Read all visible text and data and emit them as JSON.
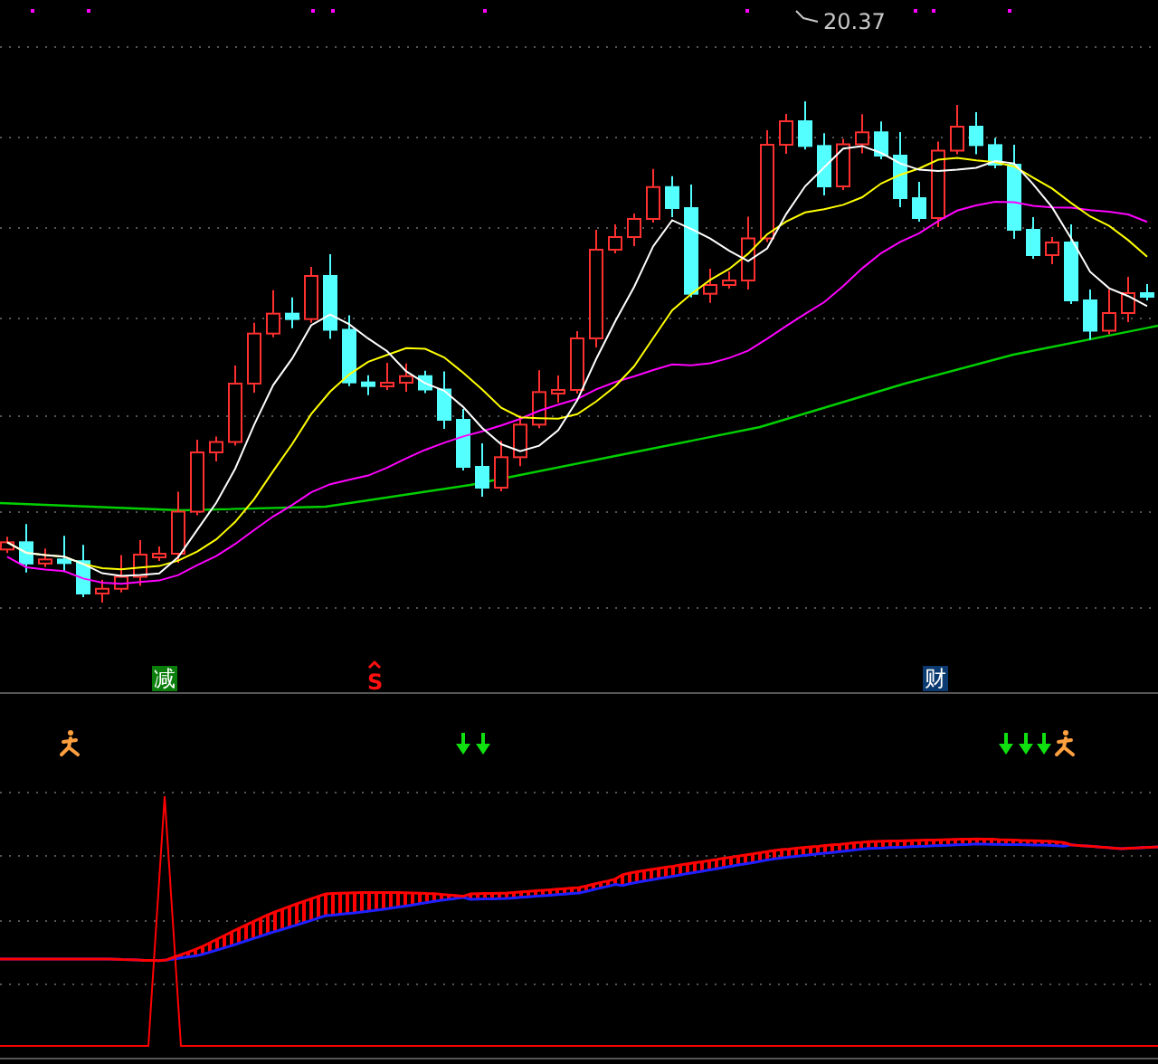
{
  "price_panel": {
    "high_label": "20.37",
    "signals": [
      {
        "kind": "tag",
        "text": "减",
        "color": "#0b7d0b"
      },
      {
        "kind": "letter",
        "text": "S",
        "color": "#ff1010"
      },
      {
        "kind": "tag",
        "text": "财",
        "color": "#0b3a70"
      }
    ]
  }
}
